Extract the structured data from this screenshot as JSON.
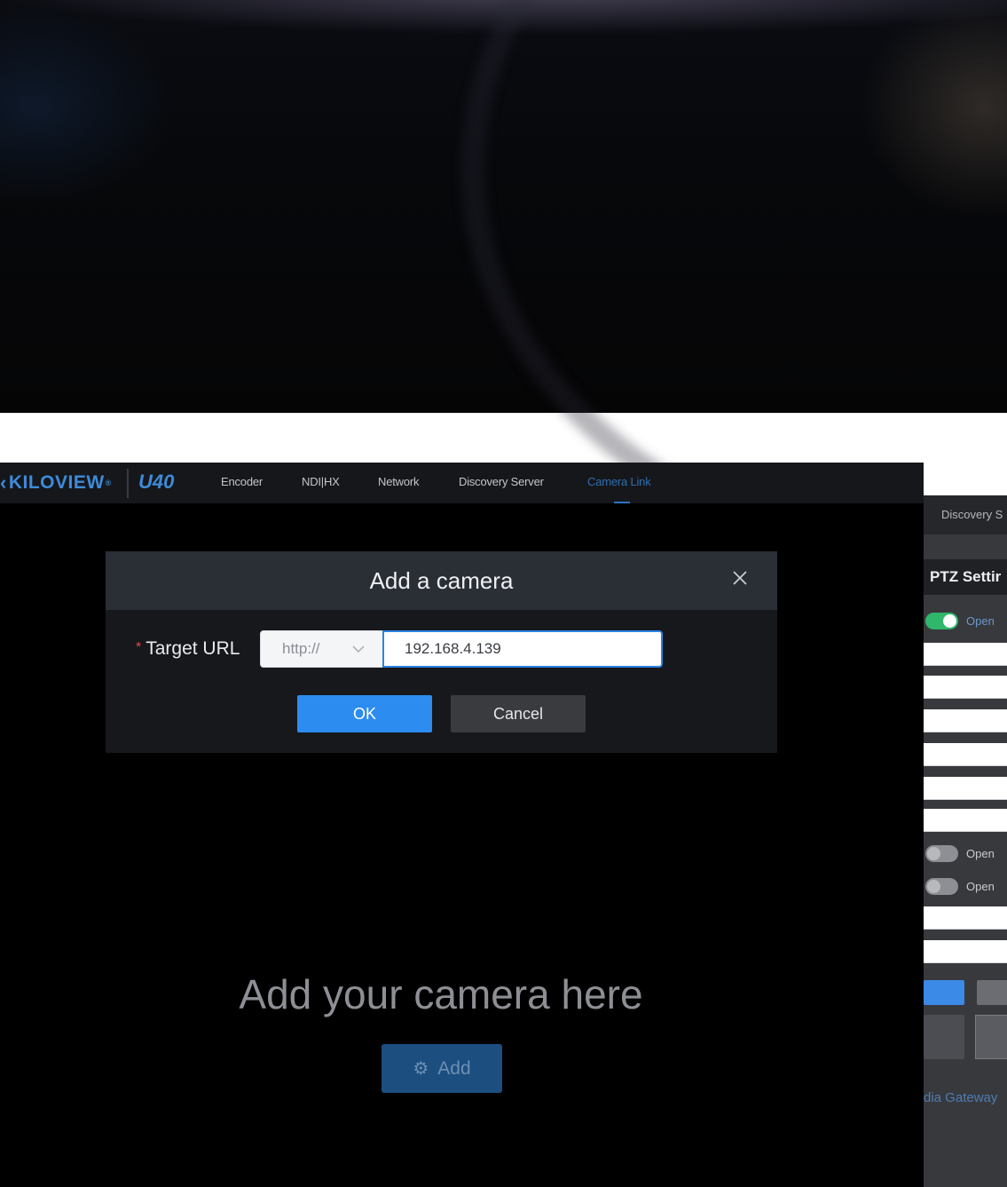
{
  "navbar": {
    "brand": "KILOVIEW",
    "model": "U40",
    "items": [
      {
        "label": "Encoder",
        "active": false
      },
      {
        "label": "NDI|HX",
        "active": false
      },
      {
        "label": "Network",
        "active": false
      },
      {
        "label": "Discovery Server",
        "active": false
      },
      {
        "label": "Camera Link",
        "active": true
      }
    ]
  },
  "modal": {
    "title": "Add a camera",
    "required_mark": "*",
    "target_url_label": "Target URL",
    "protocol_value": "http://",
    "url_value": "192.168.4.139",
    "ok_label": "OK",
    "cancel_label": "Cancel"
  },
  "main": {
    "hero_text": "Add your camera here",
    "add_button_label": "Add"
  },
  "side_panel": {
    "header": "Discovery S",
    "ptz_title": "PTZ Settir",
    "toggle_label_1": "Open",
    "toggle_label_2": "Open",
    "toggle_label_3": "Open",
    "gateway_text": "dia Gateway"
  },
  "colors": {
    "accent": "#2d8cf0",
    "brand": "#3d8bd9",
    "background": "#000000",
    "toggle_on": "#2fb86b"
  },
  "icons": {
    "close": "close-icon",
    "chevron": "chevron-down-icon",
    "add": "gear-icon"
  }
}
